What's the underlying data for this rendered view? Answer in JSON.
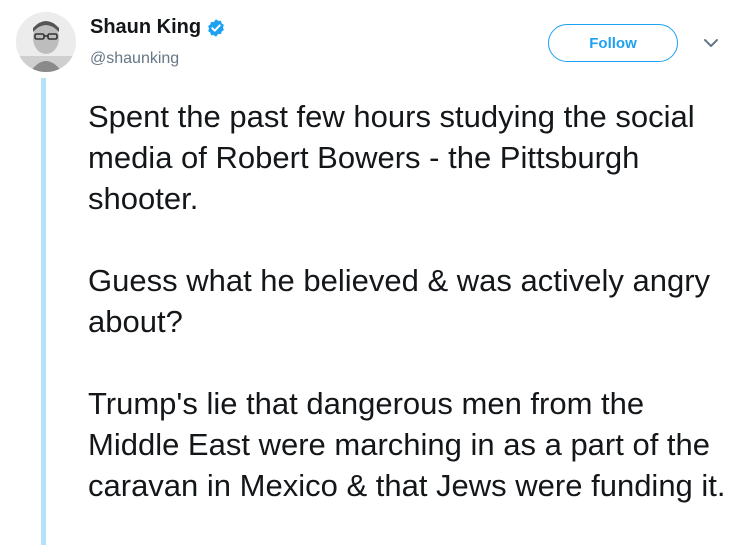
{
  "author": {
    "name": "Shaun King",
    "handle": "@shaunking",
    "verified": true
  },
  "actions": {
    "follow_label": "Follow"
  },
  "icons": {
    "verified": "verified-badge-icon",
    "more": "chevron-down-icon"
  },
  "colors": {
    "accent": "#1da1f2",
    "thread_line": "#b6e2f8",
    "handle_gray": "#657786",
    "text": "#14171a"
  },
  "tweet": {
    "paragraphs": [
      "Spent the past few hours studying the social media of Robert Bowers - the Pittsburgh shooter.",
      "Guess what he believed & was actively angry about?",
      "Trump's lie that dangerous men from the Middle East were marching in as a part of the caravan in Mexico & that Jews were funding it."
    ]
  }
}
